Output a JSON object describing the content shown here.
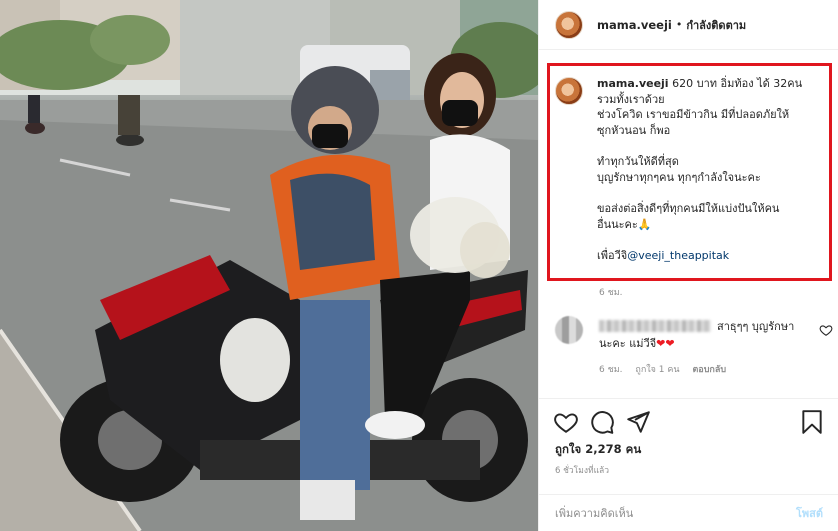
{
  "post": {
    "username": "mama.veeji",
    "separator": "•",
    "follow_status": "กำลังติดตาม",
    "caption": {
      "username": "mama.veeji",
      "line1": " 620 บาท อิ่มท้อง ได้ 32คน",
      "line2": "รวมทั้งเราด้วย",
      "line3": "ช่วงโควิด เราขอมีข้าวกิน มีที่ปลอดภัยให้",
      "line4": "ซุกหัวนอน ก็พอ",
      "line5": "ทำทุกวันให้ดีที่สุด",
      "line6": "บุญรักษาทุกๆคน ทุกๆกำลังใจนะคะ",
      "line7": "ขอส่งต่อสิ่งดีๆที่ทุกคนมีให้แบ่งปันให้คน",
      "line8": "อื่นนะคะ🙏",
      "line9_prefix": "เพื่อวีจิ",
      "mention": "@veeji_theappitak"
    },
    "caption_time": "6 ชม.",
    "comment": {
      "text_line1": "สาธุๆๆ บุญรักษา",
      "text_line2": "นะคะ แม่วีจี",
      "hearts": "❤❤",
      "time": "6 ชม.",
      "likes": "ถูกใจ 1 คน",
      "reply": "ตอบกลับ"
    },
    "likes_count": "ถูกใจ 2,278 คน",
    "posted_ago": "6 ชั่วโมงที่แล้ว",
    "comment_placeholder": "เพิ่มความคิดเห็น",
    "post_button": "โพสต์",
    "icons": [
      "heart-icon",
      "comment-icon",
      "share-icon",
      "bookmark-icon"
    ],
    "colors": {
      "highlight_box": "#e0161e",
      "mention": "#00376b",
      "post_button_disabled": "#b2dffc",
      "secondary_text": "#8e8e8e"
    }
  }
}
